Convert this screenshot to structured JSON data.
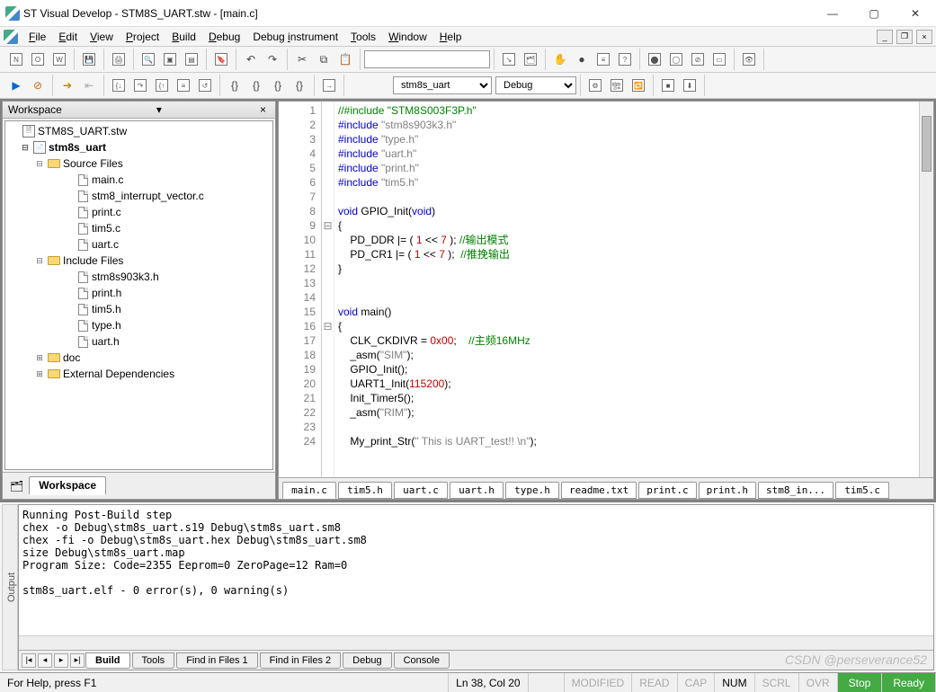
{
  "window": {
    "title": "ST Visual Develop - STM8S_UART.stw - [main.c]"
  },
  "menu": {
    "file": "File",
    "edit": "Edit",
    "view": "View",
    "project": "Project",
    "build": "Build",
    "debug": "Debug",
    "instrument": "Debug instrument",
    "tools": "Tools",
    "window": "Window",
    "help": "Help"
  },
  "toolbar2": {
    "target": "stm8s_uart",
    "config": "Debug"
  },
  "workspace": {
    "title": "Workspace",
    "root": "STM8S_UART.stw",
    "project": "stm8s_uart",
    "folders": {
      "source": {
        "label": "Source Files",
        "files": [
          "main.c",
          "stm8_interrupt_vector.c",
          "print.c",
          "tim5.c",
          "uart.c"
        ]
      },
      "include": {
        "label": "Include Files",
        "files": [
          "stm8s903k3.h",
          "print.h",
          "tim5.h",
          "type.h",
          "uart.h"
        ]
      },
      "doc": {
        "label": "doc"
      },
      "ext": {
        "label": "External Dependencies"
      }
    },
    "tab": "Workspace"
  },
  "code_lines": [
    {
      "n": 1,
      "html": "<span class='c-cm'>//#include \"STM8S003F3P.h\"</span>"
    },
    {
      "n": 2,
      "html": "<span class='c-pp'>#include</span><span class='c-str'> \"stm8s903k3.h\"</span>"
    },
    {
      "n": 3,
      "html": "<span class='c-pp'>#include</span><span class='c-str'> \"type.h\"</span>"
    },
    {
      "n": 4,
      "html": "<span class='c-pp'>#include</span><span class='c-str'> \"uart.h\"</span>"
    },
    {
      "n": 5,
      "html": "<span class='c-pp'>#include</span><span class='c-str'> \"print.h\"</span>"
    },
    {
      "n": 6,
      "html": "<span class='c-pp'>#include</span><span class='c-str'> \"tim5.h\"</span>"
    },
    {
      "n": 7,
      "html": ""
    },
    {
      "n": 8,
      "html": "<span class='c-kw'>void</span> <span class='c-id'>GPIO_Init</span>(<span class='c-kw'>void</span>)"
    },
    {
      "n": 9,
      "fold": "⊟",
      "html": "{"
    },
    {
      "n": 10,
      "html": "    PD_DDR |= ( <span class='c-num'>1</span> &lt;&lt; <span class='c-num'>7</span> ); <span class='c-cm'>//输出模式</span>"
    },
    {
      "n": 11,
      "html": "    PD_CR1 |= ( <span class='c-num'>1</span> &lt;&lt; <span class='c-num'>7</span> );  <span class='c-cm'>//推挽输出</span>"
    },
    {
      "n": 12,
      "html": "}"
    },
    {
      "n": 13,
      "html": ""
    },
    {
      "n": 14,
      "html": ""
    },
    {
      "n": 15,
      "html": "<span class='c-kw'>void</span> <span class='c-id'>main</span>()"
    },
    {
      "n": 16,
      "fold": "⊟",
      "html": "{"
    },
    {
      "n": 17,
      "html": "    CLK_CKDIVR = <span class='c-num'>0x00</span>;    <span class='c-cm'>//主频16MHz</span>"
    },
    {
      "n": 18,
      "html": "    _asm(<span class='c-str'>\"SIM\"</span>);"
    },
    {
      "n": 19,
      "html": "    GPIO_Init();"
    },
    {
      "n": 20,
      "html": "    UART1_Init(<span class='c-num'>115200</span>);"
    },
    {
      "n": 21,
      "html": "    Init_Timer5();"
    },
    {
      "n": 22,
      "html": "    _asm(<span class='c-str'>\"RIM\"</span>);"
    },
    {
      "n": 23,
      "html": ""
    },
    {
      "n": 24,
      "html": "    My_print_Str(<span class='c-str'>\" This is UART_test!! \\n\"</span>);"
    }
  ],
  "editor_tabs": [
    "main.c",
    "tim5.h",
    "uart.c",
    "uart.h",
    "type.h",
    "readme.txt",
    "print.c",
    "print.h",
    "stm8_in...",
    "tim5.c"
  ],
  "output": {
    "label": "Output",
    "text": "Running Post-Build step\nchex -o Debug\\stm8s_uart.s19 Debug\\stm8s_uart.sm8\nchex -fi -o Debug\\stm8s_uart.hex Debug\\stm8s_uart.sm8\nsize Debug\\stm8s_uart.map\nProgram Size: Code=2355 Eeprom=0 ZeroPage=12 Ram=0\n\nstm8s_uart.elf - 0 error(s), 0 warning(s)\n",
    "tabs": [
      "Build",
      "Tools",
      "Find in Files 1",
      "Find in Files 2",
      "Debug",
      "Console"
    ]
  },
  "status": {
    "hint": "For Help, press F1",
    "pos": "Ln 38, Col 20",
    "mod": "MODIFIED",
    "read": "READ",
    "cap": "CAP",
    "num": "NUM",
    "scrl": "SCRL",
    "ovr": "OVR",
    "stop": "Stop",
    "ready": "Ready"
  },
  "watermark": "CSDN @perseverance52"
}
